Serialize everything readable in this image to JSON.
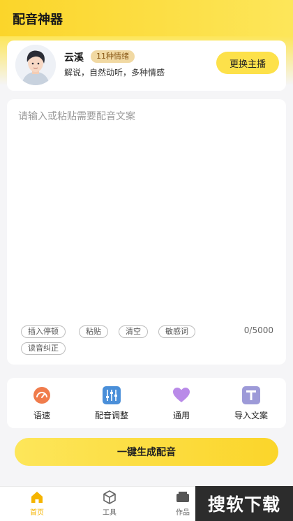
{
  "app": {
    "title": "配音神器"
  },
  "anchor": {
    "name": "云溪",
    "emotion_badge": "11种情绪",
    "description": "解说，自然动听，多种情感",
    "change_button": "更换主播"
  },
  "editor": {
    "placeholder": "请输入或粘贴需要配音文案",
    "value": "",
    "counter": "0/5000",
    "chips": [
      "插入停顿",
      "粘贴",
      "清空",
      "敏感词",
      "读音纠正"
    ]
  },
  "tools": [
    {
      "label": "语速",
      "icon": "speedometer-icon",
      "color": "#f07c4c"
    },
    {
      "label": "配音调整",
      "icon": "sliders-icon",
      "color": "#4a8fd9"
    },
    {
      "label": "通用",
      "icon": "heart-icon",
      "color": "#b98ae8"
    },
    {
      "label": "导入文案",
      "icon": "text-import-icon",
      "color": "#9d9ad8"
    }
  ],
  "generate_button": "一键生成配音",
  "tabbar": {
    "items": [
      {
        "label": "首页",
        "icon": "home-icon",
        "active": true
      },
      {
        "label": "工具",
        "icon": "box-icon",
        "active": false
      },
      {
        "label": "作品",
        "icon": "works-icon",
        "active": false
      }
    ]
  },
  "watermark": "搜软下载",
  "colors": {
    "accent": "#fbd52a",
    "active_tab": "#f5b400",
    "badge": "#f1d9a3"
  }
}
